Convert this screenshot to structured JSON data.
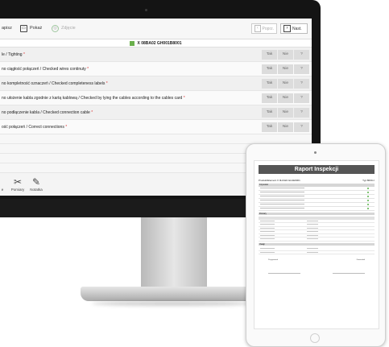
{
  "toolbar": {
    "print_label": "apisz",
    "preview_label": "Pokaż",
    "photo_label": "Zdjęcie",
    "prev_label": "Poprz.",
    "next_label": "Nast."
  },
  "form": {
    "title": "X 08BA02 GH001B8001",
    "questions": [
      {
        "text": "le / Tighting",
        "yes": "Tak",
        "no": "Nie",
        "unknown": "?"
      },
      {
        "text": "no ciągłość połączeń / Checked wires continuty",
        "yes": "Tak",
        "no": "Nie",
        "unknown": "?"
      },
      {
        "text": "no kompletność oznaczeń / Checked completeness labels",
        "yes": "Tak",
        "no": "Nie",
        "unknown": "?"
      },
      {
        "text": "no ułożenie kabla zgodnie z kartą kablową / Checked by lying the cables according to the cables card",
        "yes": "Tak",
        "no": "Nie",
        "unknown": "?"
      },
      {
        "text": "no podłączenie kabla / Checked connection cable",
        "yes": "Tak",
        "no": "Nie",
        "unknown": "?"
      },
      {
        "text": "ość połączeń / Correct connections",
        "yes": "Tak",
        "no": "Nie",
        "unknown": "?"
      }
    ],
    "required_mark": "*"
  },
  "bottom_tools": {
    "measure_label": "Pomiary",
    "note_label": "Notatka",
    "left_label": "e"
  },
  "report": {
    "title": "Raport Inspekcji",
    "product_label": "Produkt/Element X 0LGWA GH1E9001",
    "type_label": "Typ:8000-z",
    "section_checks": "Czynności",
    "section_measure": "Pomiary",
    "section_notes": "Uwagi",
    "signature_left": "Przygotował",
    "signature_right": "Zatwierdził"
  },
  "colors": {
    "check_green": "#6ab04c",
    "required_red": "#d33333",
    "monitor_bezel": "#141414"
  }
}
